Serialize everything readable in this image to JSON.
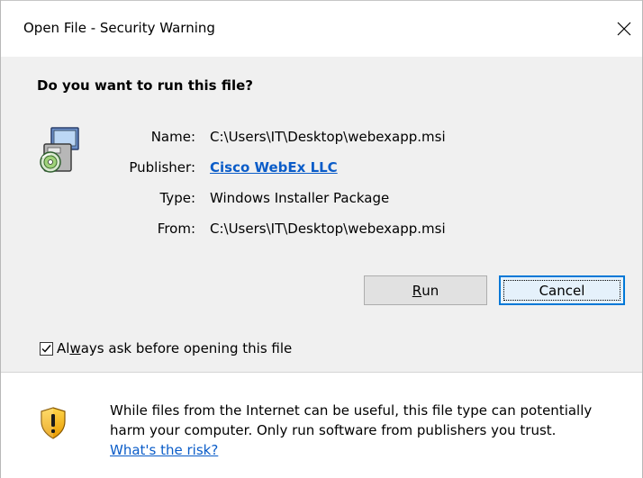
{
  "window": {
    "title": "Open File - Security Warning"
  },
  "prompt": {
    "question": "Do you want to run this file?"
  },
  "file_info": {
    "name_label": "Name:",
    "name_value": "C:\\Users\\IT\\Desktop\\webexapp.msi",
    "publisher_label": "Publisher:",
    "publisher_value": "Cisco WebEx LLC",
    "type_label": "Type:",
    "type_value": "Windows Installer Package",
    "from_label": "From:",
    "from_value": "C:\\Users\\IT\\Desktop\\webexapp.msi"
  },
  "buttons": {
    "run_prefix": "",
    "run_access": "R",
    "run_suffix": "un",
    "cancel_label": "Cancel"
  },
  "checkbox": {
    "label_prefix": "Al",
    "label_access": "w",
    "label_suffix": "ays ask before opening this file",
    "checked": true
  },
  "warning": {
    "line1": "While files from the Internet can be useful, this file type can potentially",
    "line2": "harm your computer. Only run software from publishers you trust.",
    "risk_link": "What's the risk?"
  },
  "colors": {
    "link": "#0a5cc8",
    "default_button_border": "#0078d7",
    "dialog_background": "#f0f0f0"
  },
  "icons": {
    "file": "installer-package-icon",
    "warning": "warning-shield-icon",
    "close": "close-icon"
  }
}
